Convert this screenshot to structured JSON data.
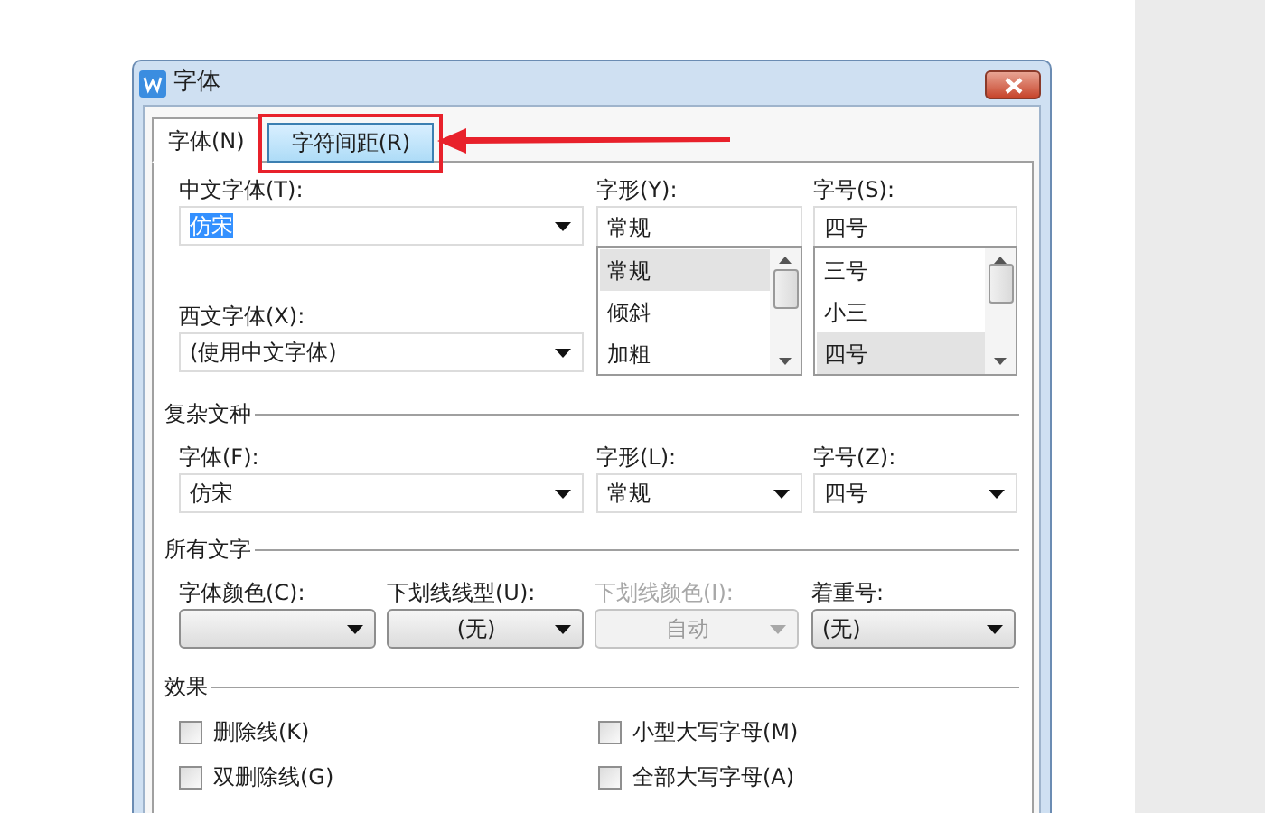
{
  "window": {
    "title": "字体"
  },
  "tabs": [
    {
      "label": "字体(N)",
      "selected": true,
      "hovered": false,
      "marked": false
    },
    {
      "label": "字符间距(R)",
      "selected": false,
      "hovered": true,
      "marked": true
    }
  ],
  "chinese_font": {
    "label": "中文字体(T):",
    "value": "仿宋"
  },
  "style": {
    "label": "字形(Y):",
    "value": "常规",
    "options": [
      {
        "label": "常规",
        "selected": true
      },
      {
        "label": "倾斜",
        "selected": false
      },
      {
        "label": "加粗",
        "selected": false
      }
    ]
  },
  "size": {
    "label": "字号(S):",
    "value": "四号",
    "options": [
      {
        "label": "三号",
        "selected": false
      },
      {
        "label": "小三",
        "selected": false
      },
      {
        "label": "四号",
        "selected": true
      }
    ]
  },
  "western_font": {
    "label": "西文字体(X):",
    "value": "(使用中文字体)"
  },
  "complex_script": {
    "title": "复杂文种",
    "fields": [
      {
        "label": "字体(F):",
        "value": "仿宋"
      },
      {
        "label": "字形(L):",
        "value": "常规"
      },
      {
        "label": "字号(Z):",
        "value": "四号"
      }
    ]
  },
  "all_text": {
    "title": "所有文字",
    "fields": [
      {
        "label": "字体颜色(C):",
        "disabled": false
      },
      {
        "label": "下划线线型(U):",
        "value": "(无)",
        "disabled": false
      },
      {
        "label": "下划线颜色(I):",
        "value": "自动",
        "disabled": true
      },
      {
        "label": "着重号:",
        "value": "(无)",
        "disabled": false
      }
    ]
  },
  "effects": {
    "title": "效果",
    "options": [
      {
        "label": "删除线(K)",
        "checked": false
      },
      {
        "label": "小型大写字母(M)",
        "checked": false
      },
      {
        "label": "双删除线(G)",
        "checked": false
      },
      {
        "label": "全部大写字母(A)",
        "checked": false
      }
    ]
  }
}
